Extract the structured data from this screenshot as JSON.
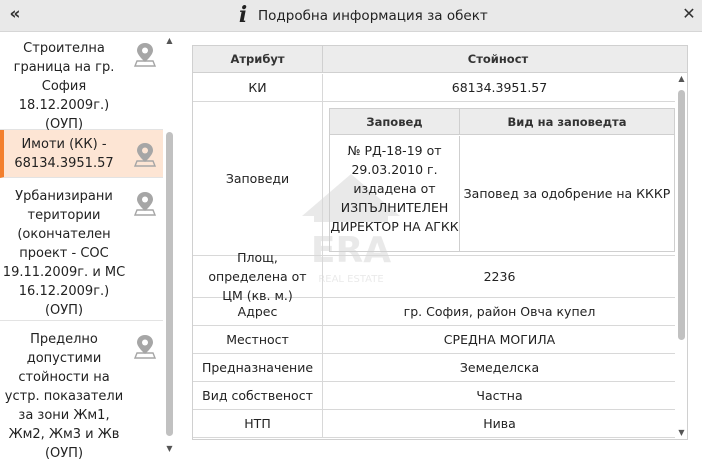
{
  "window": {
    "title": "Подробна информация за обект",
    "collapse_icon": "double-chevron-left-icon",
    "info_icon": "info-icon",
    "close_icon": "close-icon"
  },
  "sidebar": {
    "items": [
      {
        "label": "Строителна граница на гр. София 18.12.2009г.) (ОУП)",
        "icon": "map-pin-icon",
        "active": false
      },
      {
        "label": "Имоти (КК) - 68134.3951.57",
        "icon": "map-pin-icon",
        "active": true
      },
      {
        "label": "Урбанизирани територии (окончателен проект - СОС 19.11.2009г. и МС 16.12.2009г.) (ОУП)",
        "icon": "map-pin-icon",
        "active": false
      },
      {
        "label": "Пределно допустими стойности на устр. показатели за зони Жм1, Жм2, Жм3 и Жв (ОУП)",
        "icon": "map-pin-icon",
        "active": false
      }
    ]
  },
  "table": {
    "header": {
      "attr": "Атрибут",
      "val": "Стойност"
    },
    "rows": {
      "ki": {
        "attr": "КИ",
        "val": "68134.3951.57"
      },
      "orders": {
        "attr": "Заповеди",
        "sub_header": {
          "order": "Заповед",
          "type": "Вид на заповедта"
        },
        "sub_row": {
          "order": "№ РД-18-19 от 29.03.2010 г. издадена от ИЗПЪЛНИТЕЛЕН ДИРЕКТОР НА АГКК",
          "type": "Заповед за одобрение на КККР"
        }
      },
      "area": {
        "attr": "Площ, определена от ЦМ (кв. м.)",
        "val": "2236"
      },
      "address": {
        "attr": "Адрес",
        "val": "гр. София, район Овча купел"
      },
      "locality": {
        "attr": "Местност",
        "val": "СРЕДНА МОГИЛА"
      },
      "purpose": {
        "attr": "Предназначение",
        "val": "Земеделска"
      },
      "ownership": {
        "attr": "Вид собственост",
        "val": "Частна"
      },
      "ntp": {
        "attr": "НТП",
        "val": "Нива"
      }
    }
  },
  "watermark": {
    "text": "ERA",
    "subtext": "REAL ESTATE"
  },
  "colors": {
    "accent": "#f37f2d",
    "active_bg": "#fde5d4",
    "header_bg": "#ececec"
  }
}
